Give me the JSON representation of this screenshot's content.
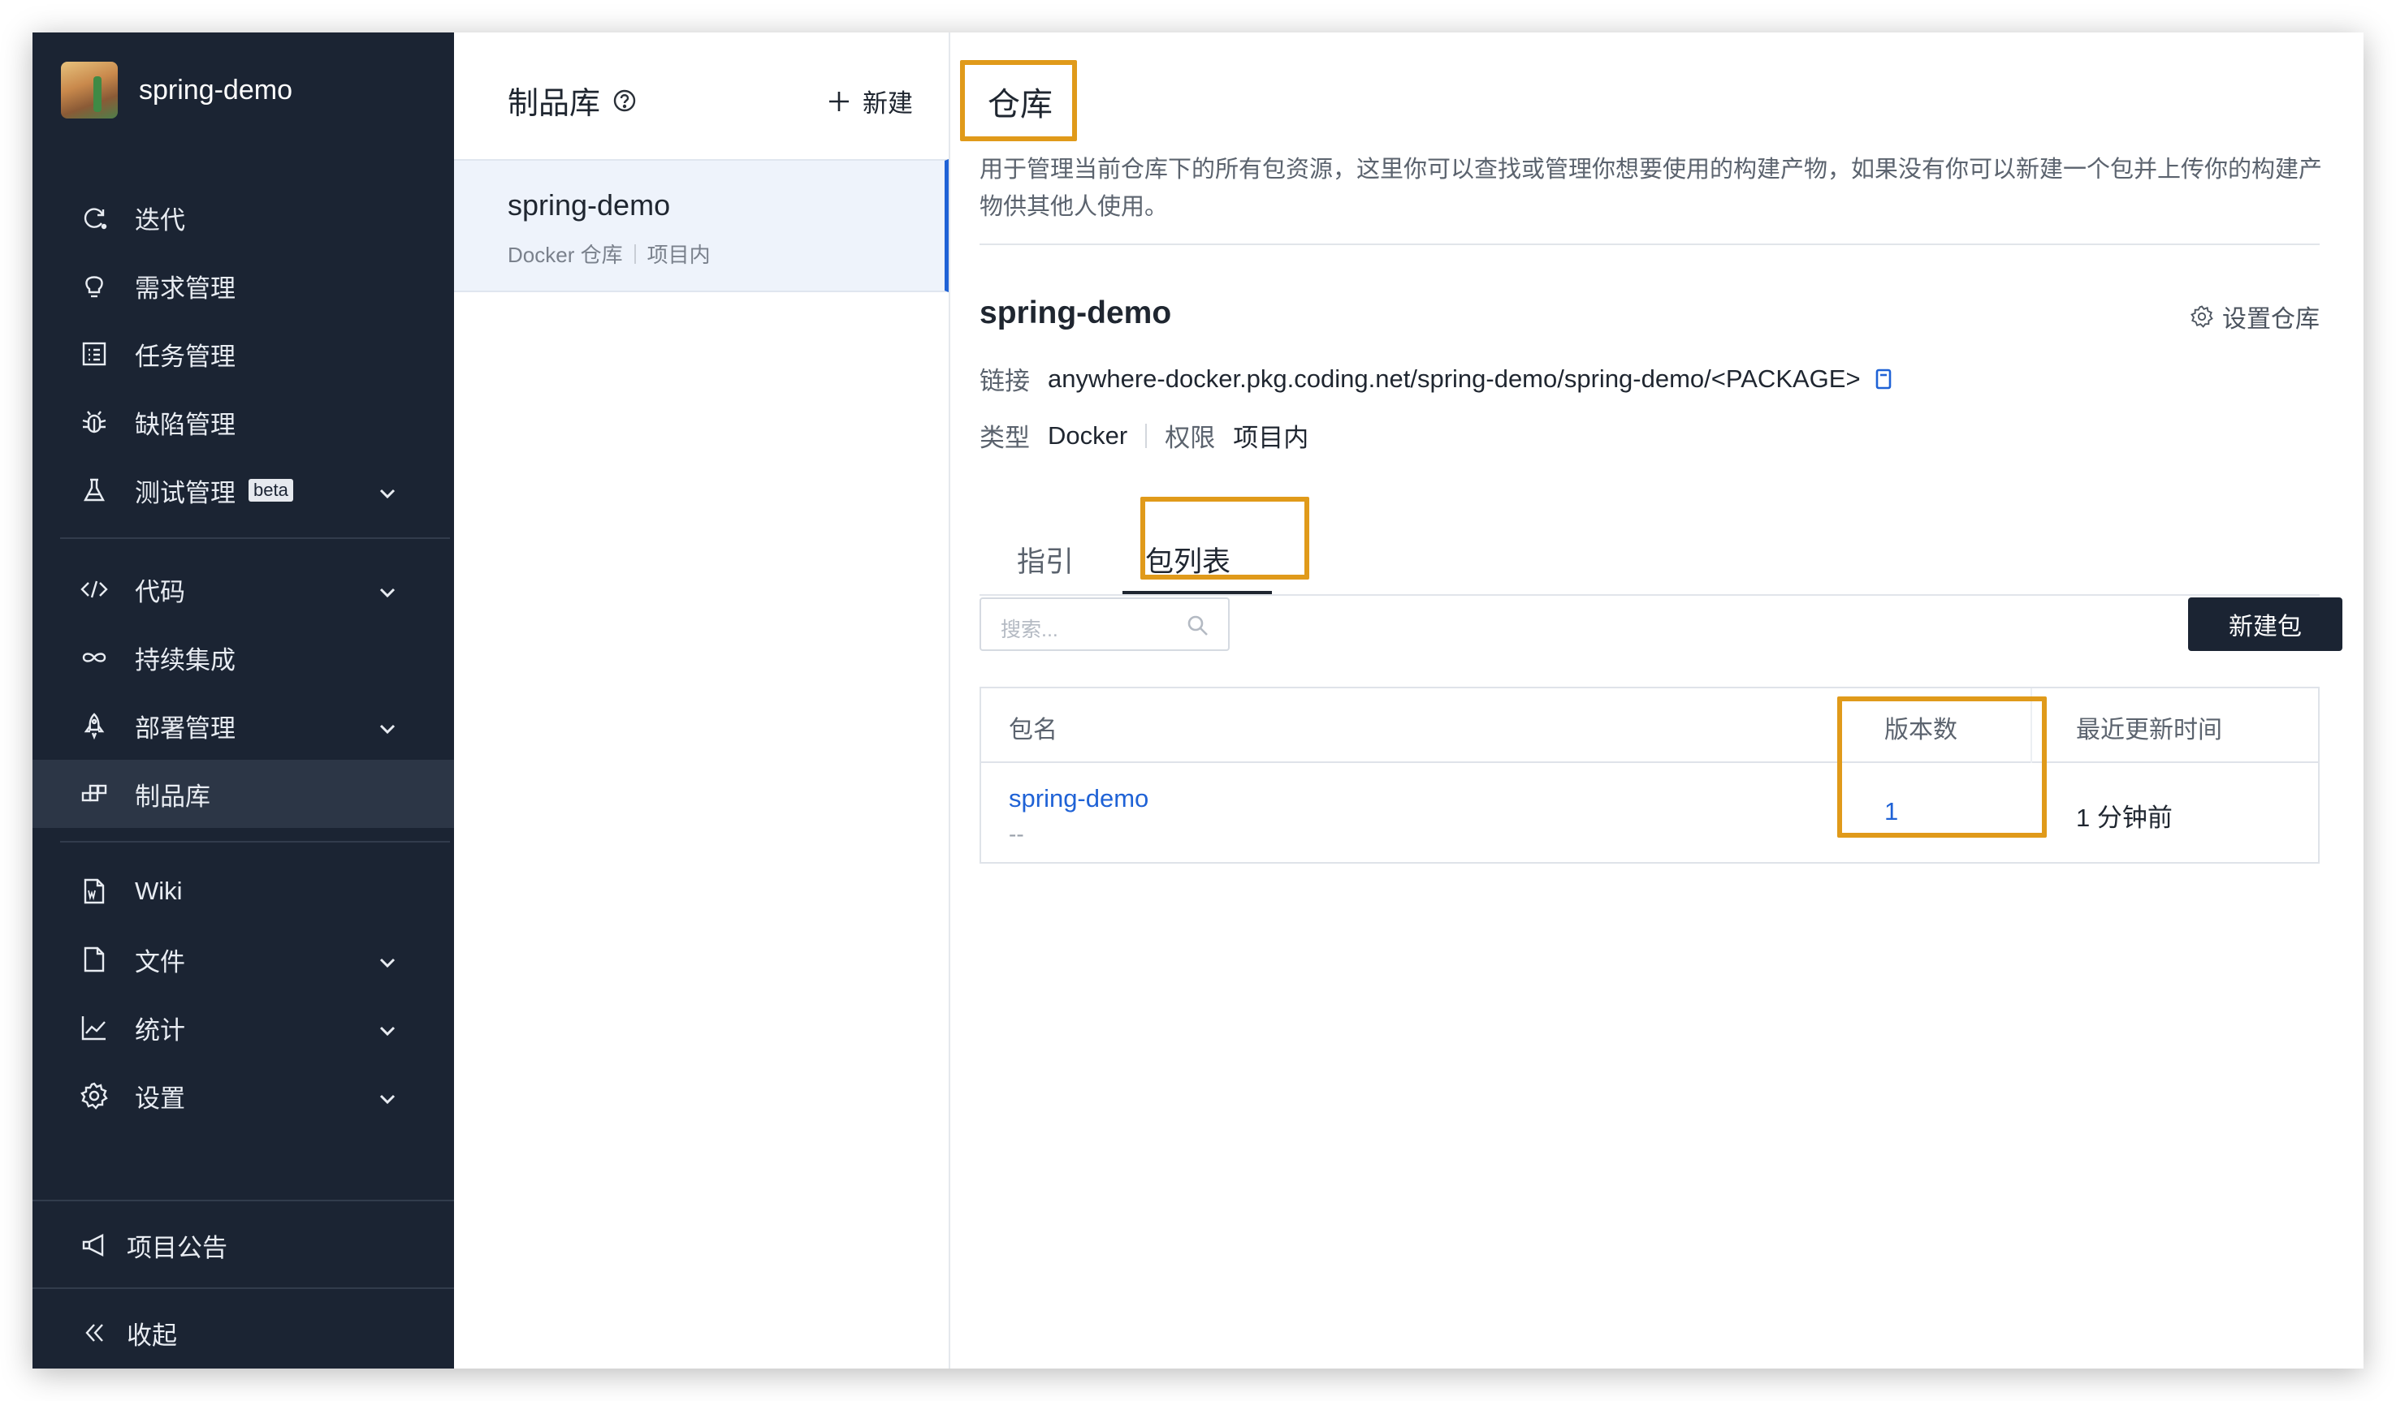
{
  "project": {
    "name": "spring-demo"
  },
  "sidebar": {
    "items": [
      {
        "label": "迭代",
        "icon": "iteration-icon"
      },
      {
        "label": "需求管理",
        "icon": "lightbulb-icon"
      },
      {
        "label": "任务管理",
        "icon": "task-list-icon"
      },
      {
        "label": "缺陷管理",
        "icon": "bug-icon"
      },
      {
        "label": "测试管理",
        "icon": "flask-icon",
        "badge": "beta"
      },
      {
        "label": "代码",
        "icon": "code-icon"
      },
      {
        "label": "持续集成",
        "icon": "infinity-icon"
      },
      {
        "label": "部署管理",
        "icon": "rocket-icon"
      },
      {
        "label": "制品库",
        "icon": "artifact-icon"
      },
      {
        "label": "Wiki",
        "icon": "wiki-doc-icon"
      },
      {
        "label": "文件",
        "icon": "file-icon"
      },
      {
        "label": "统计",
        "icon": "chart-icon"
      },
      {
        "label": "设置",
        "icon": "gear-icon"
      }
    ],
    "announcement": "项目公告",
    "collapse": "收起"
  },
  "list_panel": {
    "title": "制品库",
    "new_label": "新建",
    "repo": {
      "name": "spring-demo",
      "type": "Docker 仓库",
      "scope": "项目内"
    }
  },
  "main": {
    "title": "仓库",
    "description": "用于管理当前仓库下的所有包资源，这里你可以查找或管理你想要使用的构建产物，如果没有你可以新建一个包并上传你的构建产物供其他人使用。",
    "repo_name": "spring-demo",
    "settings_label": "设置仓库",
    "link_label": "链接",
    "link_value": "anywhere-docker.pkg.coding.net/spring-demo/spring-demo/<PACKAGE>",
    "type_label": "类型",
    "type_value": "Docker",
    "perm_label": "权限",
    "perm_value": "项目内",
    "tabs": [
      {
        "label": "指引"
      },
      {
        "label": "包列表"
      }
    ],
    "search_placeholder": "搜索...",
    "new_package_label": "新建包",
    "table": {
      "headers": [
        "包名",
        "版本数",
        "最近更新时间"
      ],
      "rows": [
        {
          "name": "spring-demo",
          "desc": "--",
          "versions": "1",
          "updated": "1 分钟前"
        }
      ]
    }
  },
  "colors": {
    "sidebar_bg": "#1b2433",
    "accent": "#1f62d6",
    "highlight": "#e09a1a"
  }
}
